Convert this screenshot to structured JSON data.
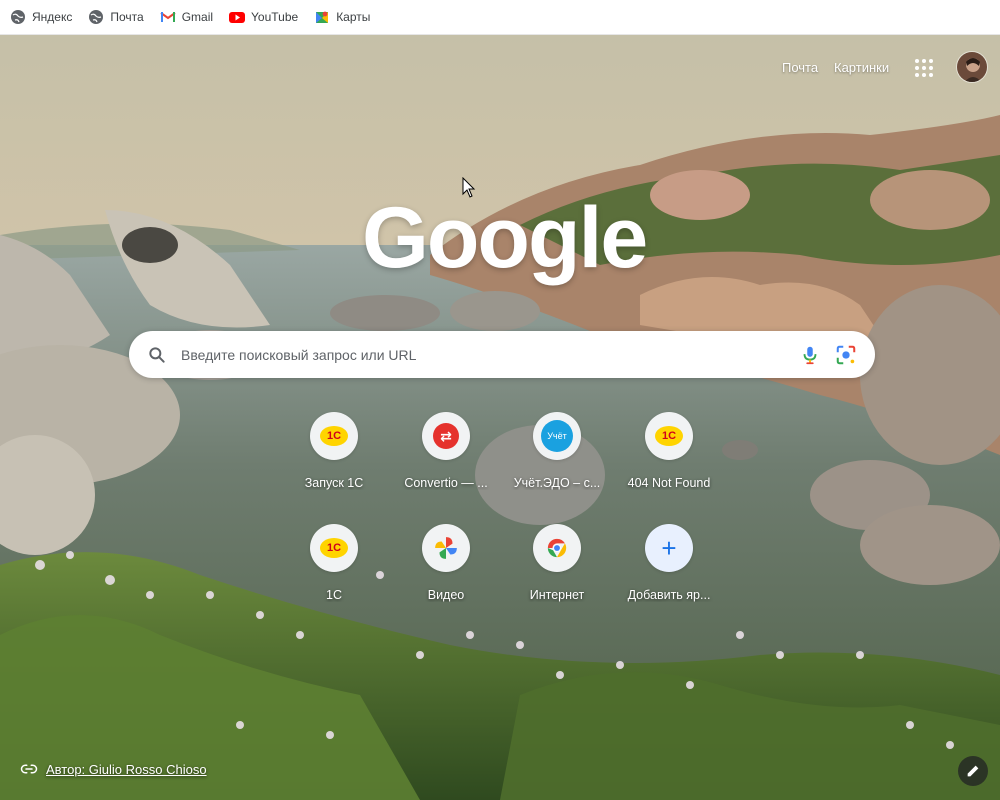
{
  "bookmarks": [
    {
      "label": "Яндекс",
      "icon": "globe-icon"
    },
    {
      "label": "Почта",
      "icon": "globe-icon"
    },
    {
      "label": "Gmail",
      "icon": "gmail-icon"
    },
    {
      "label": "YouTube",
      "icon": "youtube-icon"
    },
    {
      "label": "Карты",
      "icon": "maps-icon"
    }
  ],
  "header": {
    "mail_link": "Почта",
    "images_link": "Картинки",
    "apps_icon": "apps-grid-icon",
    "avatar_icon": "account-avatar"
  },
  "logo": {
    "text": "Google"
  },
  "search": {
    "placeholder": "Введите поисковый запрос или URL"
  },
  "shortcuts": [
    {
      "label": "Запуск 1С",
      "icon": "1c-icon"
    },
    {
      "label": "Convertio — ...",
      "icon": "convertio-icon"
    },
    {
      "label": "Учёт.ЭДО – с...",
      "icon": "uchet-icon",
      "icon_text": "Учёт"
    },
    {
      "label": "404 Not Found",
      "icon": "1c-icon"
    },
    {
      "label": "1С",
      "icon": "1c-icon"
    },
    {
      "label": "Видео",
      "icon": "photos-pinwheel-icon"
    },
    {
      "label": "Интернет",
      "icon": "chrome-icon"
    },
    {
      "label": "Добавить яр...",
      "icon": "plus-icon"
    }
  ],
  "badge_1c": "1C",
  "attribution": {
    "text": "Автор: Giulio Rosso Chioso"
  },
  "colors": {
    "accent": "#1a73e8",
    "badge_1c": "#ffd400",
    "convertio": "#e5322d",
    "uchet": "#1aa1e0"
  }
}
